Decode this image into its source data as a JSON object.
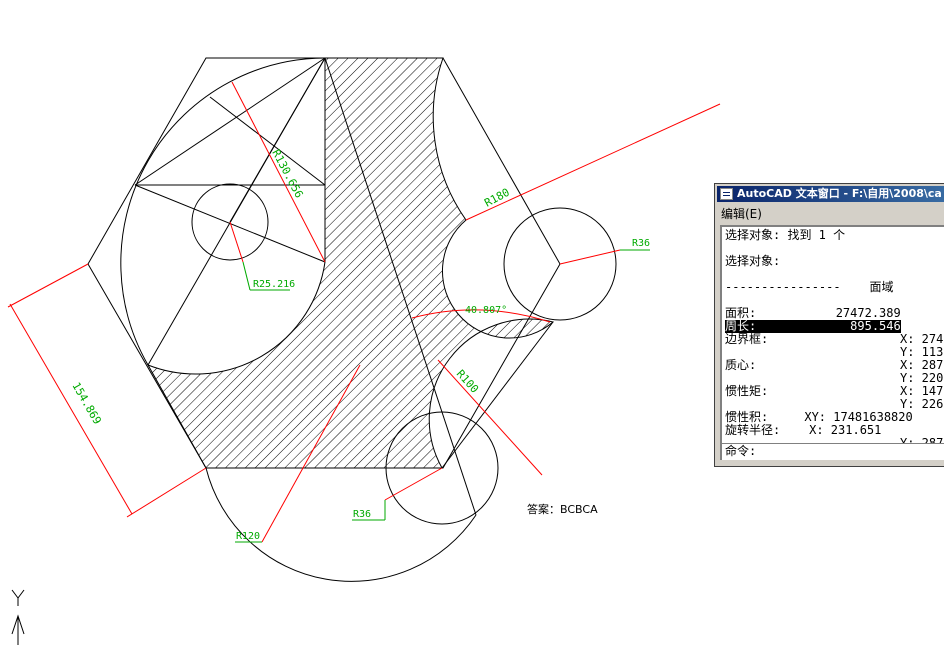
{
  "drawing": {
    "dim_r30": "R130.656",
    "dim_r25": "R25.216",
    "dim_r180": "R180",
    "dim_r36_right": "R36",
    "dim_angle": "40.807°",
    "dim_r100": "R100",
    "dim_length": "154.869",
    "dim_r120": "R120",
    "dim_r36_bottom": "R36",
    "answer": "答案：BCBCA"
  },
  "ucs": {
    "y_label": "Y"
  },
  "text_window": {
    "title": "AutoCAD 文本窗口 - F:\\自用\\2008\\ca",
    "menu_edit": "编辑(E)",
    "lines": {
      "select_found": "选择对象: 找到 1 个",
      "select_obj": "选择对象:",
      "separator": "----------------    面域",
      "area": "面积:           27472.389",
      "perimeter": "周长:             895.546",
      "bbox_label": "边界框:",
      "bbox_x": "X: 274",
      "bbox_y": "Y: 113",
      "centroid_label": "质心:",
      "centroid_x": "X: 287",
      "centroid_y": "Y: 220",
      "inertia_label": "惯性矩:",
      "inertia_x": "X: 147",
      "inertia_y": "Y: 226",
      "product": "惯性积:     XY: 17481638820",
      "gyration": "旋转半径:    X: 231.651",
      "gyration_y": "Y: 287",
      "command": "命令:"
    }
  }
}
